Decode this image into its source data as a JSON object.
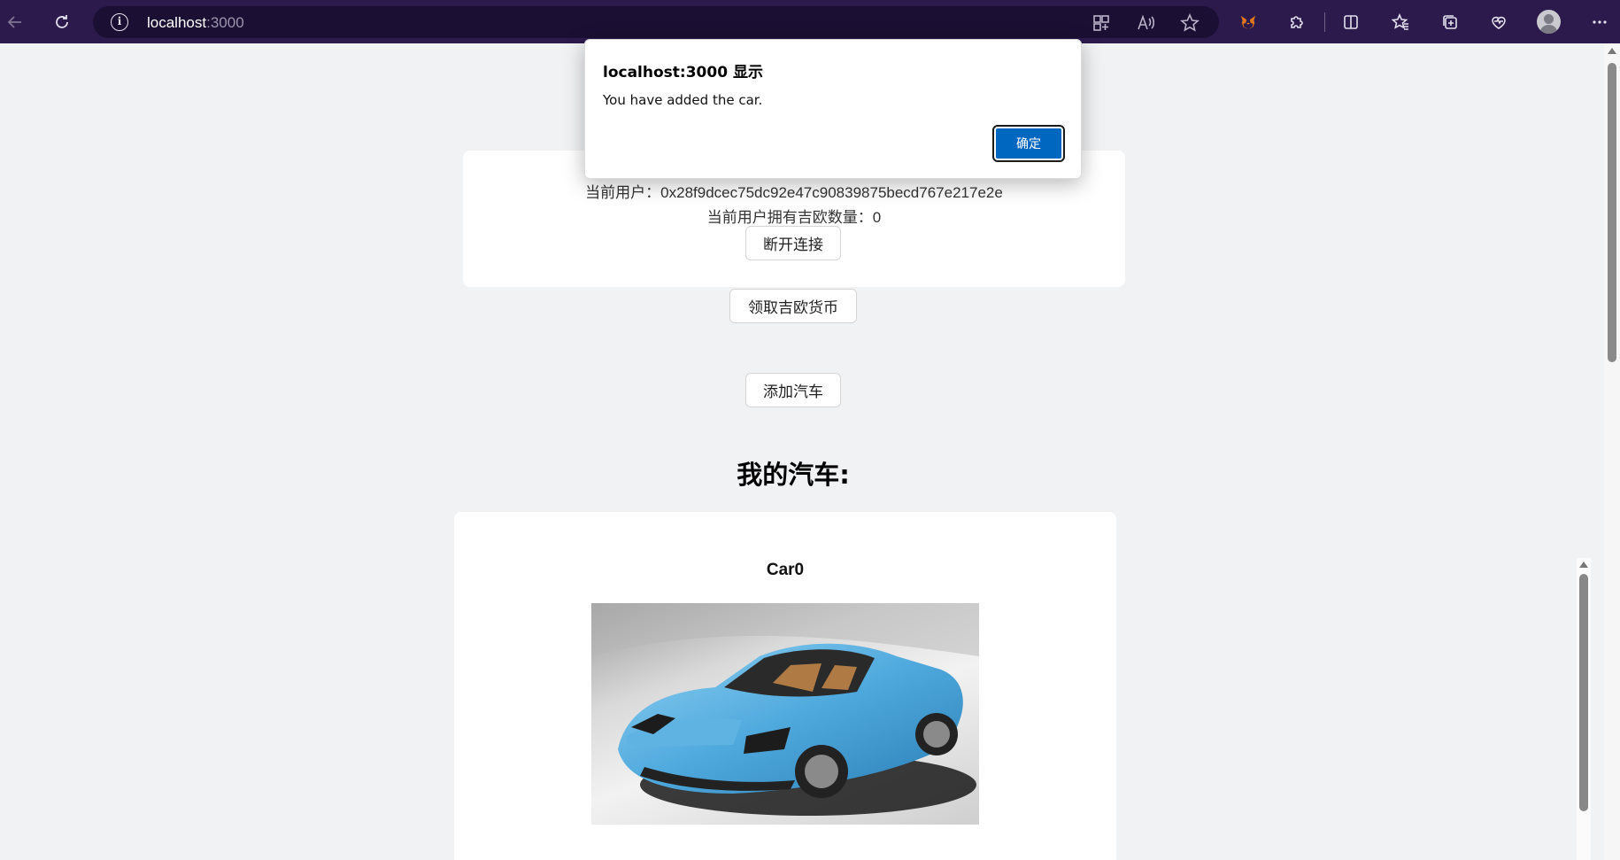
{
  "browser": {
    "url_host": "localhost",
    "url_port": ":3000"
  },
  "page": {
    "current_user_label": "当前用户：0x28f9dcec75dc92e47c90839875becd767e217e2e",
    "token_count_label": "当前用户拥有吉欧数量：0",
    "disconnect_button": "断开连接",
    "claim_button": "领取吉欧货币",
    "add_car_button": "添加汽车",
    "my_cars_heading": "我的汽车:",
    "cars": [
      {
        "name": "Car0"
      }
    ]
  },
  "dialog": {
    "title": "localhost:3000 显示",
    "message": "You have added the car.",
    "ok_button": "确定"
  },
  "colors": {
    "toolbar_bg": "#2c1a4d",
    "page_bg": "#f1f2f4",
    "dialog_ok_bg": "#0067c0",
    "car_color": "#5fb3e3"
  }
}
